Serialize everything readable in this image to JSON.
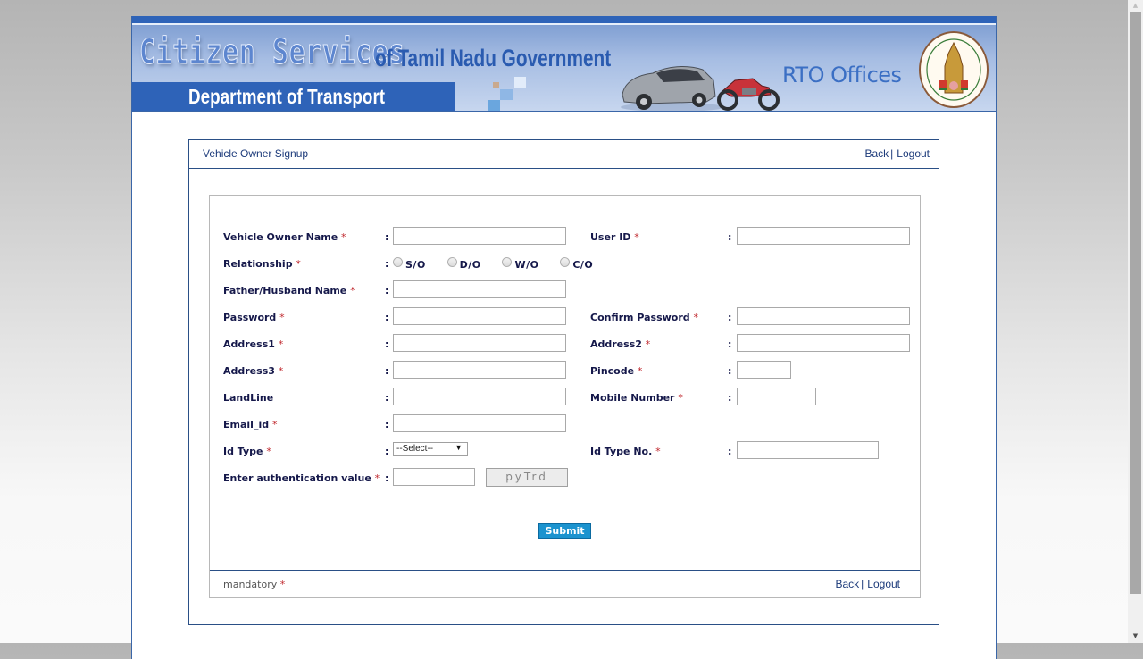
{
  "banner": {
    "title_big": "Citizen Services",
    "title_small": "of Tamil Nadu Government",
    "department": "Department of Transport",
    "rto": "RTO Offices"
  },
  "panel": {
    "title": "Vehicle Owner Signup",
    "back": "Back",
    "separator": "|",
    "logout": "Logout"
  },
  "form": {
    "required_mark": "*",
    "colon": ":",
    "fields": {
      "owner_name": {
        "label": "Vehicle Owner Name",
        "value": ""
      },
      "user_id": {
        "label": "User ID",
        "value": ""
      },
      "relationship": {
        "label": "Relationship",
        "options": [
          "S/O",
          "D/O",
          "W/O",
          "C/O"
        ]
      },
      "father_name": {
        "label": "Father/Husband Name",
        "value": ""
      },
      "password": {
        "label": "Password",
        "value": ""
      },
      "confirm_password": {
        "label": "Confirm Password",
        "value": ""
      },
      "address1": {
        "label": "Address1",
        "value": ""
      },
      "address2": {
        "label": "Address2",
        "value": ""
      },
      "address3": {
        "label": "Address3",
        "value": ""
      },
      "pincode": {
        "label": "Pincode",
        "value": ""
      },
      "landline": {
        "label": "LandLine",
        "value": ""
      },
      "mobile": {
        "label": "Mobile Number",
        "value": ""
      },
      "email": {
        "label": "Email_id",
        "value": ""
      },
      "id_type": {
        "label": "Id Type",
        "selected": "--Select--"
      },
      "id_type_no": {
        "label": "Id Type No.",
        "value": ""
      },
      "auth_value": {
        "label": "Enter authentication value",
        "value": "",
        "captcha": "pyTrd"
      }
    },
    "submit": "Submit",
    "mandatory_note": "mandatory"
  },
  "colors": {
    "brand_blue": "#2e63b8",
    "label_navy": "#15184a",
    "required_red": "#c0282e",
    "submit_blue": "#1b93cf"
  }
}
